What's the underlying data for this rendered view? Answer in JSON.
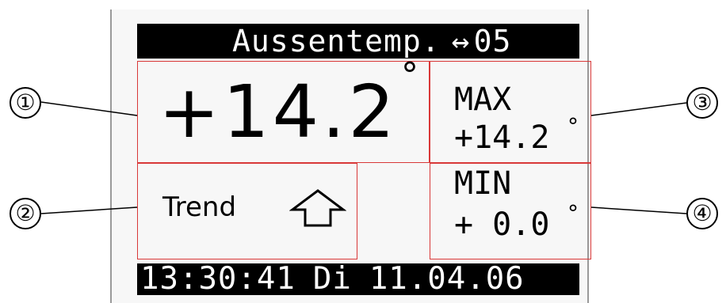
{
  "header": {
    "title": "Aussentemp.",
    "arrow_icon": "↔",
    "channel": "05"
  },
  "current": {
    "value": "+14.2",
    "degree": "°"
  },
  "max": {
    "label": "MAX",
    "value": "+14.2",
    "degree": "°"
  },
  "min": {
    "label": "MIN",
    "value": "+ 0.0",
    "degree": "°"
  },
  "trend": {
    "label": "Trend",
    "icon": "arrow-up-outline-icon"
  },
  "status": {
    "time": "13:30:41",
    "weekday": "Di",
    "date": "11.04.06"
  },
  "callouts": [
    "①",
    "②",
    "③",
    "④"
  ],
  "colors": {
    "highlight_box": "#d93838",
    "bar_background": "#000000",
    "bar_text": "#ffffff"
  }
}
